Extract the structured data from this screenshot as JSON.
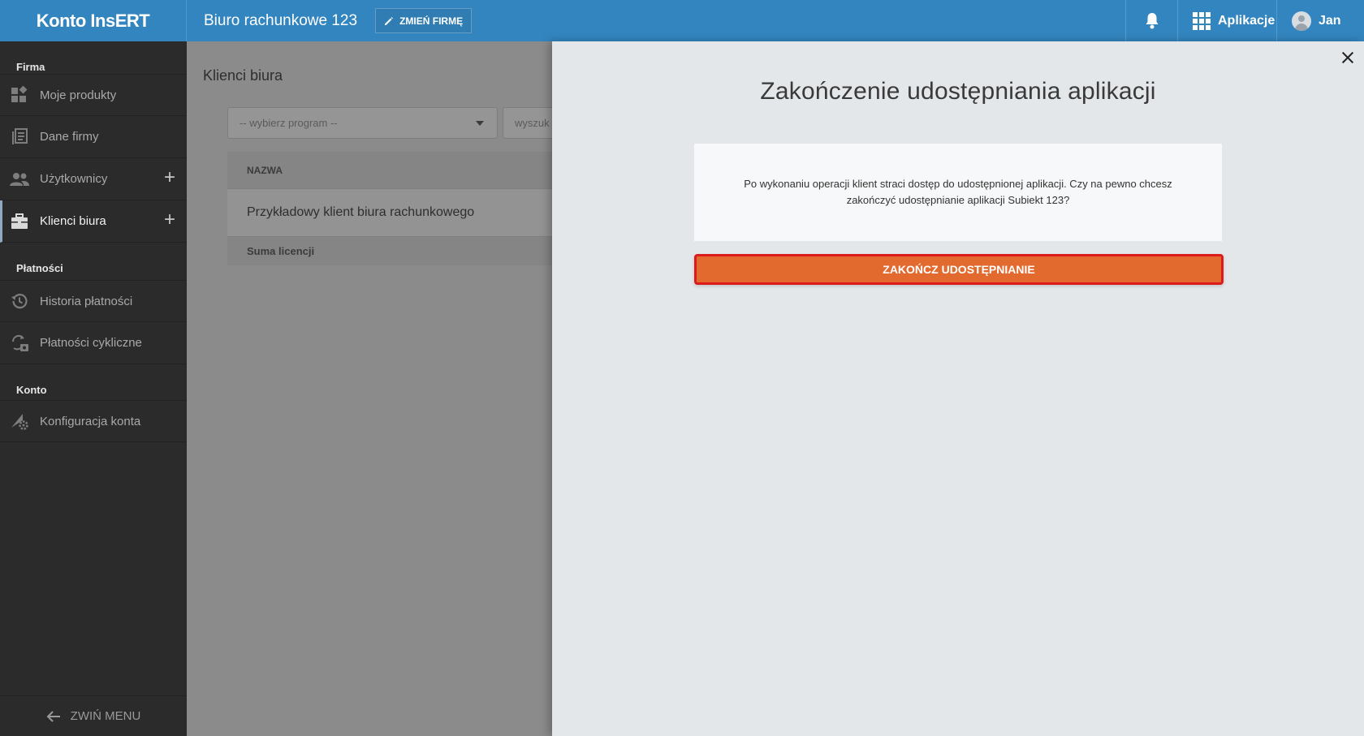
{
  "topbar": {
    "brand": "Konto InsERT",
    "company": "Biuro rachunkowe 123",
    "change_company": "ZMIEŃ FIRMĘ",
    "apps_label": "Aplikacje",
    "user_name": "Jan"
  },
  "sidebar": {
    "sections": [
      {
        "label": "Firma"
      },
      {
        "label": "Płatności"
      },
      {
        "label": "Konto"
      }
    ],
    "items": [
      {
        "label": "Moje produkty",
        "icon": "widgets-icon"
      },
      {
        "label": "Dane firmy",
        "icon": "document-list-icon"
      },
      {
        "label": "Użytkownicy",
        "icon": "users-icon"
      },
      {
        "label": "Klienci biura",
        "icon": "briefcase-icon"
      },
      {
        "label": "Historia płatności",
        "icon": "history-icon"
      },
      {
        "label": "Płatności cykliczne",
        "icon": "recurring-payment-icon"
      },
      {
        "label": "Konfiguracja konta",
        "icon": "settings-icon"
      }
    ],
    "collapse_label": "ZWIŃ MENU"
  },
  "main": {
    "title": "Klienci biura",
    "select_placeholder": "-- wybierz program --",
    "search_placeholder": "wyszuk",
    "table": {
      "header": "NAZWA",
      "rows": [
        "Przykładowy klient biura rachunkowego"
      ],
      "footer": "Suma licencji"
    }
  },
  "dialog": {
    "title": "Zakończenie udostępniania aplikacji",
    "message": "Po wykonaniu operacji klient straci dostęp do udostępnionej aplikacji. Czy na pewno chcesz zakończyć udostępnianie aplikacji Subiekt 123?",
    "confirm_label": "ZAKOŃCZ UDOSTĘPNIANIE"
  },
  "colors": {
    "topbar": "#3385bf",
    "sidebar": "#2b2b2b",
    "confirm": "#e36a2e",
    "highlight": "#dd1b1b"
  }
}
